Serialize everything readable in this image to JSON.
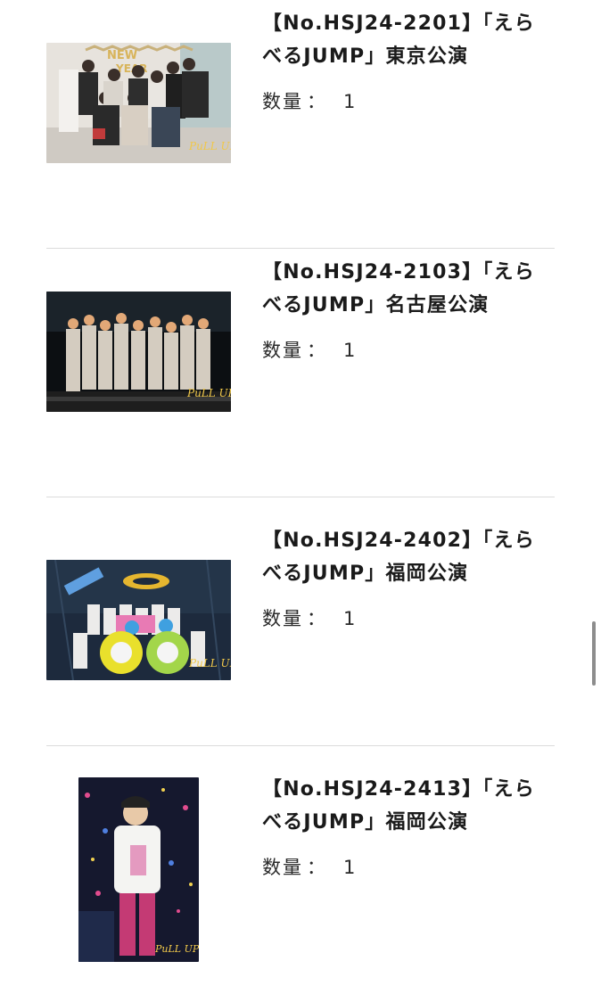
{
  "items": [
    {
      "title": "【No.HSJ24-2201】「えらべるJUMP」東京公演",
      "quantity_label": "数量",
      "separator": "：",
      "quantity": "1",
      "photo_kind": "group-photo-new-year-banner"
    },
    {
      "title": "【No.HSJ24-2103】「えらべるJUMP」名古屋公演",
      "quantity_label": "数量",
      "separator": "：",
      "quantity": "1",
      "photo_kind": "group-photo-stage-white-outfits"
    },
    {
      "title": "【No.HSJ24-2402】「えらべるJUMP」福岡公演",
      "quantity_label": "数量",
      "separator": "：",
      "quantity": "1",
      "photo_kind": "group-photo-stage-props"
    },
    {
      "title": "【No.HSJ24-2413】「えらべるJUMP」福岡公演",
      "quantity_label": "数量",
      "separator": "：",
      "quantity": "1",
      "photo_kind": "solo-photo-stage-portrait"
    }
  ],
  "colors": {
    "divider": "#dcdcdc",
    "text": "#1a1a1a",
    "scrollbar": "#8d8d8d"
  }
}
